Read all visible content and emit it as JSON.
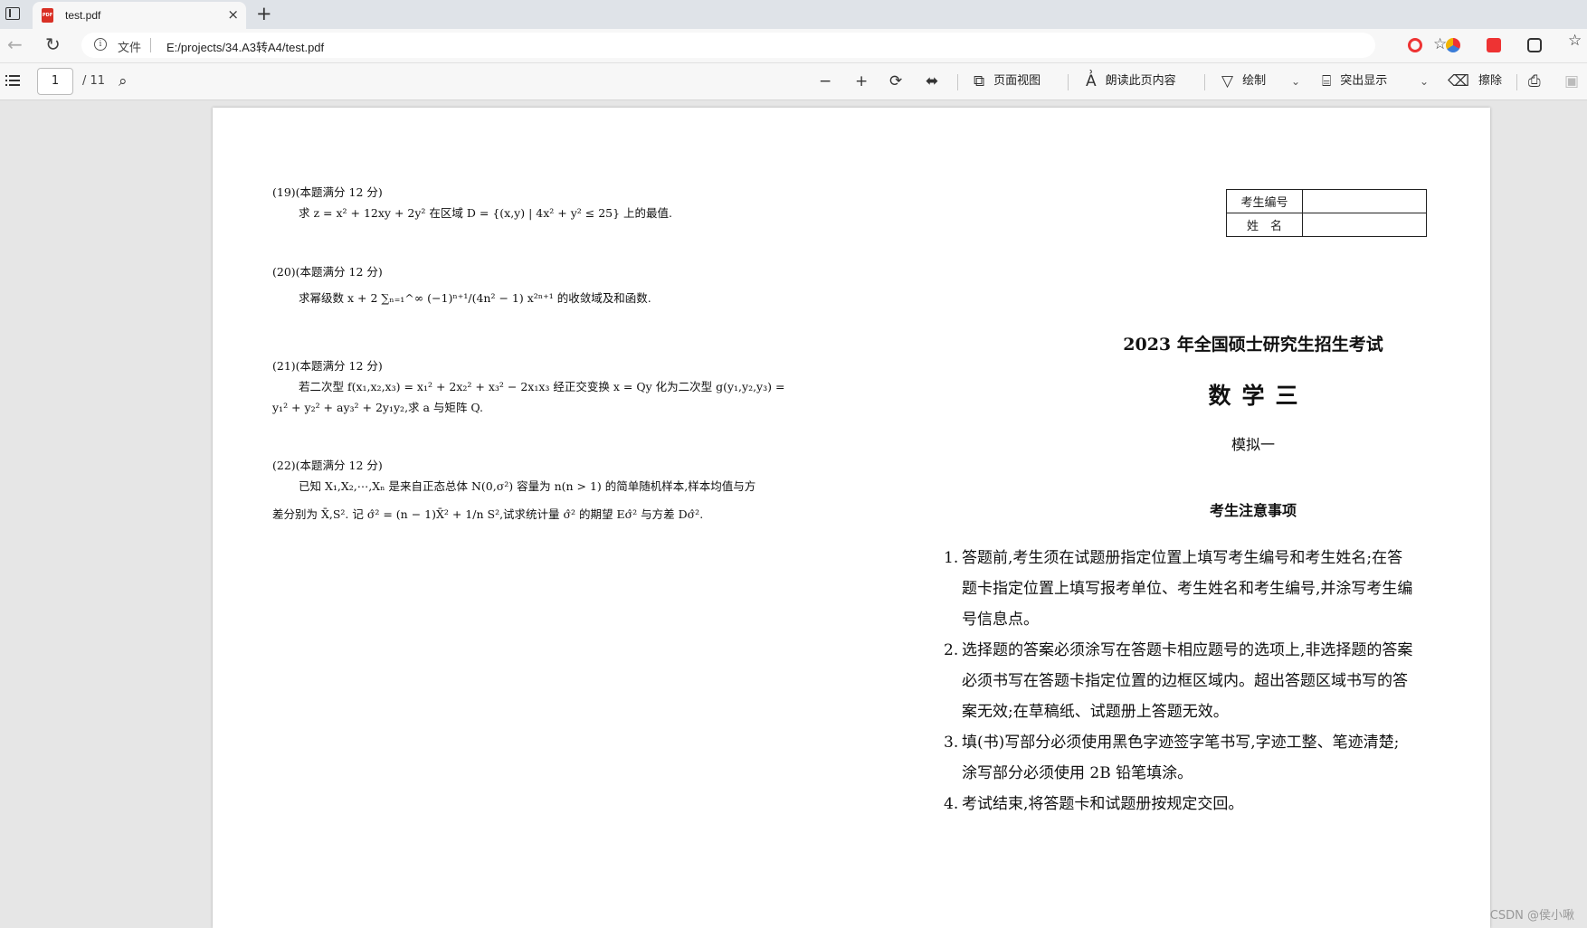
{
  "browser": {
    "tab": {
      "title": "test.pdf",
      "close_glyph": "×",
      "icon_text": "PDF"
    },
    "new_tab_glyph": "+",
    "address": {
      "file_label": "文件",
      "url": "E:/projects/34.A3转A4/test.pdf"
    }
  },
  "pdf_toolbar": {
    "page_current": "1",
    "page_total": "/ 11",
    "page_view_label": "页面视图",
    "read_aloud_label": "朗读此页内容",
    "draw_label": "绘制",
    "highlight_label": "突出显示",
    "erase_label": "擦除"
  },
  "document": {
    "questions": [
      {
        "header": "(19)(本题满分 12 分)",
        "body": "求 z = x² + 12xy + 2y² 在区域 D = {(x,y) | 4x² + y² ≤ 25} 上的最值."
      },
      {
        "header": "(20)(本题满分 12 分)",
        "body": "求幂级数 x + 2 ∑ₙ₌₁^∞ (−1)ⁿ⁺¹/(4n² − 1) x²ⁿ⁺¹ 的收敛域及和函数."
      },
      {
        "header": "(21)(本题满分 12 分)",
        "body": "若二次型 f(x₁,x₂,x₃) = x₁² + 2x₂² + x₃² − 2x₁x₃ 经正交变换 x = Qy 化为二次型 g(y₁,y₂,y₃) =",
        "cont": "y₁² + y₂² + ay₃² + 2y₁y₂,求 a 与矩阵 Q."
      },
      {
        "header": "(22)(本题满分 12 分)",
        "body": "已知 X₁,X₂,⋯,Xₙ 是来自正态总体 N(0,σ²) 容量为 n(n > 1) 的简单随机样本,样本均值与方",
        "cont": "差分别为 X̄,S². 记 σ̂² = (n − 1)X̄² + 1/n S²,试求统计量 σ̂² 的期望 Eσ̂² 与方差 Dσ̂²."
      }
    ],
    "id_table": {
      "exam_number_label": "考生编号",
      "name_label": "姓　名"
    },
    "cover": {
      "title": "2023 年全国硕士研究生招生考试",
      "subject": "数学三",
      "mock": "模拟一",
      "notes_heading": "考生注意事项",
      "notes": [
        {
          "num": "1.",
          "text": "答题前,考生须在试题册指定位置上填写考生编号和考生姓名;在答题卡指定位置上填写报考单位、考生姓名和考生编号,并涂写考生编号信息点。"
        },
        {
          "num": "2.",
          "text": "选择题的答案必须涂写在答题卡相应题号的选项上,非选择题的答案必须书写在答题卡指定位置的边框区域内。超出答题区域书写的答案无效;在草稿纸、试题册上答题无效。"
        },
        {
          "num": "3.",
          "text": "填(书)写部分必须使用黑色字迹签字笔书写,字迹工整、笔迹清楚;涂写部分必须使用 2B 铅笔填涂。"
        },
        {
          "num": "4.",
          "text": "考试结束,将答题卡和试题册按规定交回。"
        }
      ]
    }
  },
  "watermark": "CSDN @侯小啾",
  "icons": {
    "back": "back-arrow-icon",
    "reload": "reload-icon",
    "info": "info-icon",
    "favorite": "add-favorite-icon",
    "toc": "list-icon",
    "search": "search-icon",
    "zoom_out": "minus-icon",
    "zoom_in": "plus-icon",
    "rotate": "rotate-icon",
    "fit": "fit-width-icon"
  }
}
